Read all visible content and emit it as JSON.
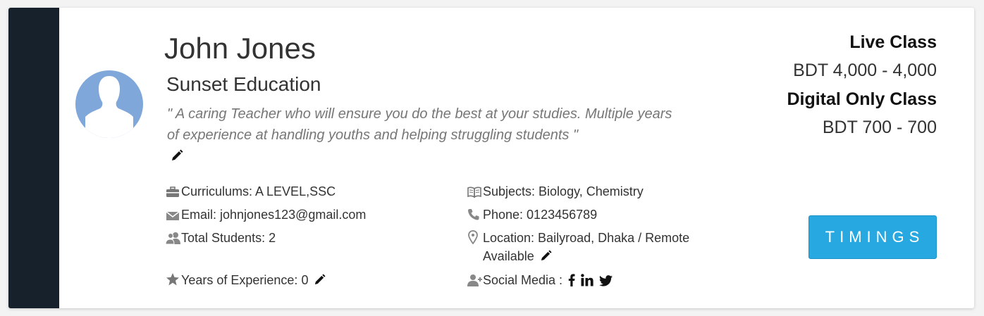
{
  "profile": {
    "name": "John Jones",
    "organization": "Sunset Education",
    "quote": "\" A caring Teacher who will ensure you do the best at your studies. Multiple years of experience at handling youths and helping struggling students \""
  },
  "details": {
    "curriculums": "Curriculums: A LEVEL,SSC",
    "email": "Email: johnjones123@gmail.com",
    "total_students": "Total Students: 2",
    "experience": "Years of Experience: 0",
    "subjects": "Subjects: Biology, Chemistry",
    "phone": "Phone: 0123456789",
    "location": "Location: Bailyroad, Dhaka / Remote Available",
    "social_media": "Social Media :"
  },
  "pricing": {
    "live_label": "Live Class",
    "live_price": "BDT 4,000 - 4,000",
    "digital_label": "Digital Only Class",
    "digital_price": "BDT 700 - 700"
  },
  "actions": {
    "timings_label": "TIMINGS"
  },
  "icons": {
    "curriculums": "briefcase-icon",
    "email": "envelope-icon",
    "students": "users-icon",
    "experience": "star-icon",
    "subjects": "book-icon",
    "phone": "phone-icon",
    "location": "map-marker-icon",
    "social": "user-plus-icon",
    "edit": "pencil-icon",
    "facebook": "facebook-icon",
    "linkedin": "linkedin-icon",
    "twitter": "twitter-icon"
  },
  "colors": {
    "sidebar": "#16212b",
    "avatar": "#7fa7d9",
    "button": "#27a8e0"
  }
}
